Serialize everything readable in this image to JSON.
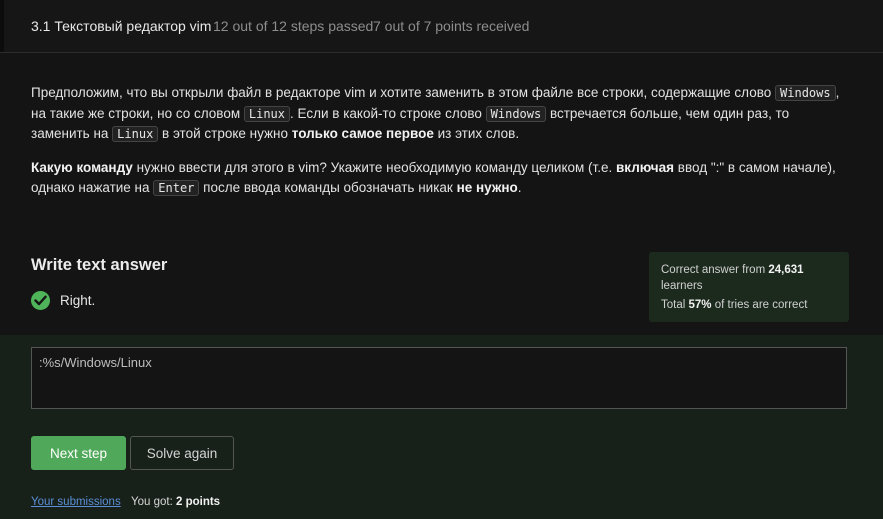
{
  "header": {
    "lesson_title": "3.1 Текстовый редактор vim",
    "steps_passed": "12 out of 12 steps passed",
    "points_received": "7 out of 7 points  received"
  },
  "step": {
    "p1_a": "Предположим, что вы открыли файл в редакторе vim и хотите заменить в этом файле все строки, содержащие слово ",
    "code_windows": "Windows",
    "p1_b": ", на такие же строки, но со словом ",
    "code_linux": "Linux",
    "p1_c": ". Если в какой-то строке слово ",
    "p1_d": " встречается больше, чем один раз, то заменить на ",
    "p1_e": " в этой строке нужно ",
    "p1_bold": "только самое первое",
    "p1_f": " из этих слов.",
    "p2_bold1": "Какую команду",
    "p2_a": " нужно ввести для этого в vim? Укажите необходимую команду целиком (т.е. ",
    "p2_bold2": "включая",
    "p2_b": " ввод \":\" в самом начале), однако нажатие на ",
    "code_enter": "Enter",
    "p2_c": " после ввода команды обозначать никак ",
    "p2_bold3": "не нужно",
    "p2_d": "."
  },
  "answer": {
    "title": "Write text answer",
    "status": "Right.",
    "value": ":%s/Windows/Linux"
  },
  "stats": {
    "correct_prefix": "Correct answer from ",
    "learners_count": "24,631",
    "learners_label": "learners",
    "total_prefix": "Total ",
    "percent": "57%",
    "total_suffix": " of tries are correct"
  },
  "actions": {
    "next_label": "Next step",
    "solve_again_label": "Solve again",
    "submissions_link": "Your submissions",
    "you_got_prefix": "You got: ",
    "you_got_points": "2 points"
  },
  "colors": {
    "accent_green": "#50a95a",
    "link_blue": "#5b8fd6",
    "stats_bg": "#1c2a1e"
  }
}
